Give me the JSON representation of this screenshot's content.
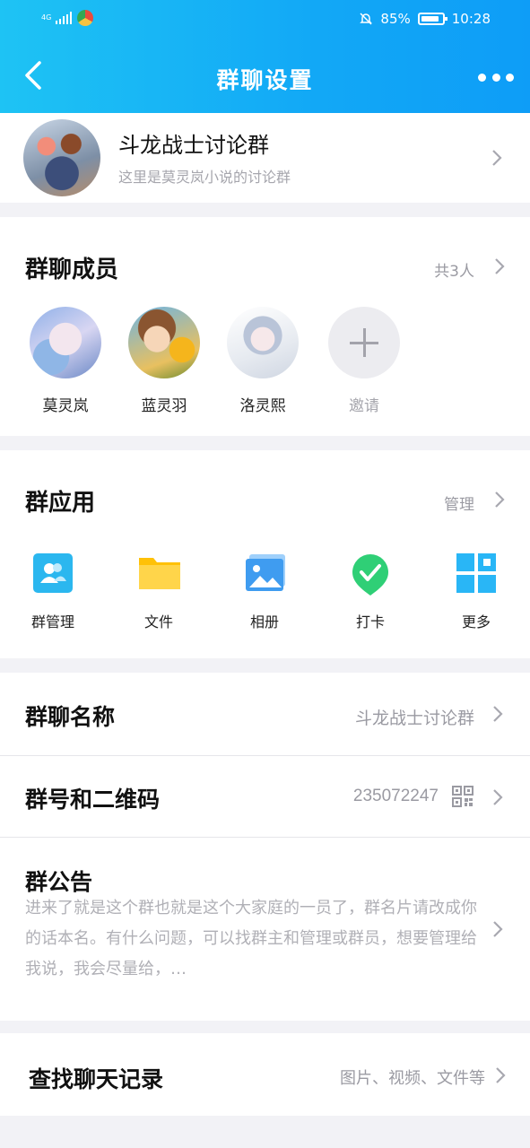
{
  "status_bar": {
    "signal_label": "4G",
    "battery_percent": "85%",
    "time": "10:28",
    "icons": [
      "signal-icon",
      "app-notification-icon",
      "mute-bell-icon",
      "battery-icon"
    ]
  },
  "nav": {
    "title": "群聊设置",
    "back_icon": "back-chevron-icon",
    "more_icon": "more-dots-icon"
  },
  "group": {
    "name": "斗龙战士讨论群",
    "description": "这里是莫灵岚小说的讨论群"
  },
  "members": {
    "title": "群聊成员",
    "count": "共3人",
    "list": [
      {
        "name": "莫灵岚"
      },
      {
        "name": "蓝灵羽"
      },
      {
        "name": "洛灵熙"
      }
    ],
    "invite_label": "邀请"
  },
  "apps": {
    "title": "群应用",
    "manage_label": "管理",
    "items": [
      {
        "label": "群管理",
        "icon": "group-manage-icon",
        "color": "#29b6f6"
      },
      {
        "label": "文件",
        "icon": "folder-icon",
        "color": "#ffc107"
      },
      {
        "label": "相册",
        "icon": "album-icon",
        "color": "#42a5f5"
      },
      {
        "label": "打卡",
        "icon": "check-in-icon",
        "color": "#2ecc71"
      },
      {
        "label": "更多",
        "icon": "more-grid-icon",
        "color": "#29b6f6"
      }
    ]
  },
  "settings": {
    "group_name": {
      "label": "群聊名称",
      "value": "斗龙战士讨论群"
    },
    "group_number": {
      "label": "群号和二维码",
      "value": "235072247"
    },
    "announcement": {
      "label": "群公告",
      "text": "进来了就是这个群也就是这个大家庭的一员了，群名片请改成你的话本名。有什么问题，可以找群主和管理或群员，想要管理给我说，我会尽量给，…"
    }
  },
  "search": {
    "label": "查找聊天记录",
    "hint": "图片、视频、文件等"
  },
  "colors": {
    "header_gradient_start": "#1ec3f4",
    "header_gradient_end": "#0e9df7",
    "page_background": "#f2f2f6",
    "secondary_text": "#9a9aa2"
  }
}
